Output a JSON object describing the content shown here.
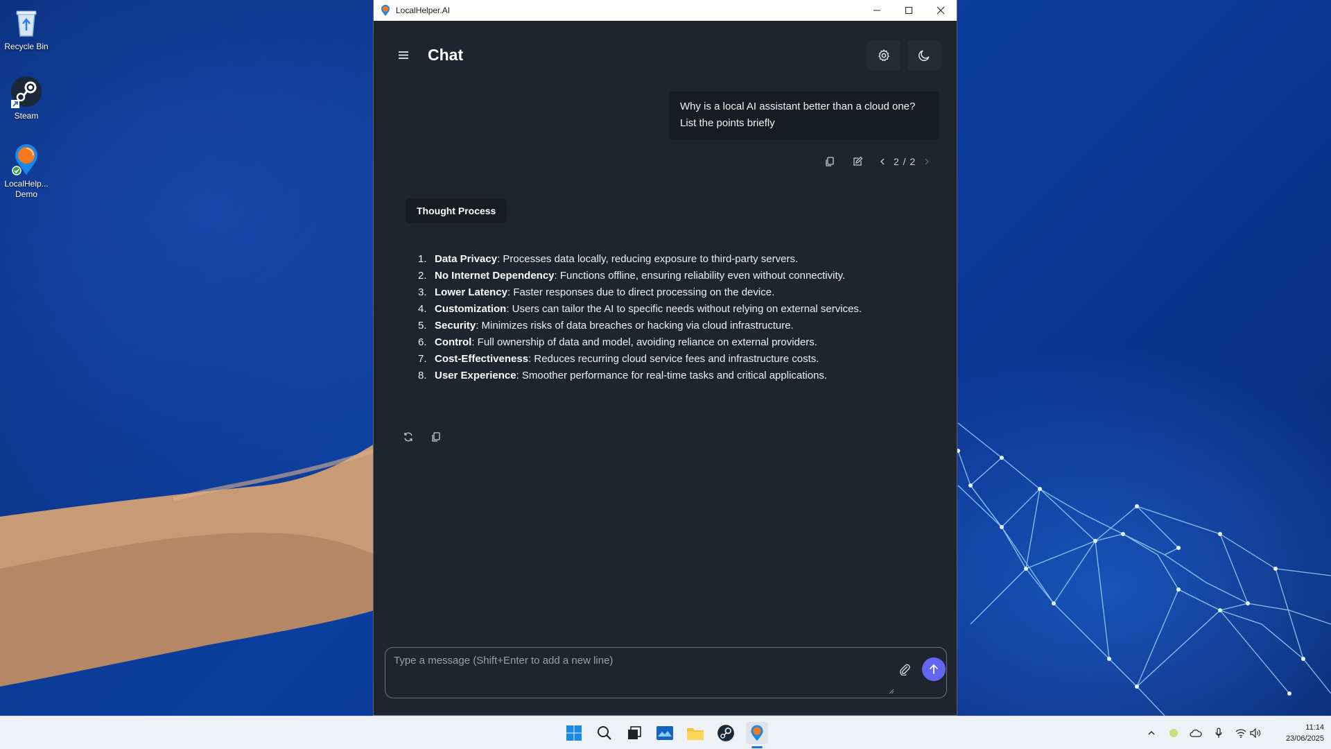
{
  "desktop": {
    "icons": [
      {
        "label": "Recycle Bin",
        "icon": "recycle-bin-icon"
      },
      {
        "label": "Steam",
        "icon": "steam-icon"
      },
      {
        "label": "LocalHelp... Demo",
        "icon": "localhelper-icon"
      }
    ]
  },
  "window": {
    "title": "LocalHelper.AI",
    "controls": {
      "minimize": "minimize-icon",
      "maximize": "maximize-icon",
      "close": "close-icon"
    }
  },
  "header": {
    "title": "Chat",
    "settings_icon": "gear-icon",
    "theme_icon": "moon-icon"
  },
  "user_message": {
    "text": "Why is a local AI assistant better than a cloud one? List the points briefly",
    "pager": "2 / 2"
  },
  "assistant": {
    "thought_process_label": "Thought Process",
    "points": [
      {
        "num": "1.",
        "title": "Data Privacy",
        "text": ": Processes data locally, reducing exposure to third-party servers."
      },
      {
        "num": "2.",
        "title": "No Internet Dependency",
        "text": ": Functions offline, ensuring reliability even without connectivity."
      },
      {
        "num": "3.",
        "title": "Lower Latency",
        "text": ": Faster responses due to direct processing on the device."
      },
      {
        "num": "4.",
        "title": "Customization",
        "text": ": Users can tailor the AI to specific needs without relying on external services."
      },
      {
        "num": "5.",
        "title": "Security",
        "text": ": Minimizes risks of data breaches or hacking via cloud infrastructure."
      },
      {
        "num": "6.",
        "title": "Control",
        "text": ": Full ownership of data and model, avoiding reliance on external providers."
      },
      {
        "num": "7.",
        "title": "Cost-Effectiveness",
        "text": ": Reduces recurring cloud service fees and infrastructure costs."
      },
      {
        "num": "8.",
        "title": "User Experience",
        "text": ": Smoother performance for real-time tasks and critical applications."
      }
    ]
  },
  "composer": {
    "placeholder": "Type a message (Shift+Enter to add a new line)",
    "value": ""
  },
  "taskbar": {
    "clock_time": "11:14",
    "clock_date": "23/06/2025",
    "accent": "#1a73e8"
  },
  "colors": {
    "send_button": "#6366f1",
    "window_bg": "#1f252e"
  }
}
